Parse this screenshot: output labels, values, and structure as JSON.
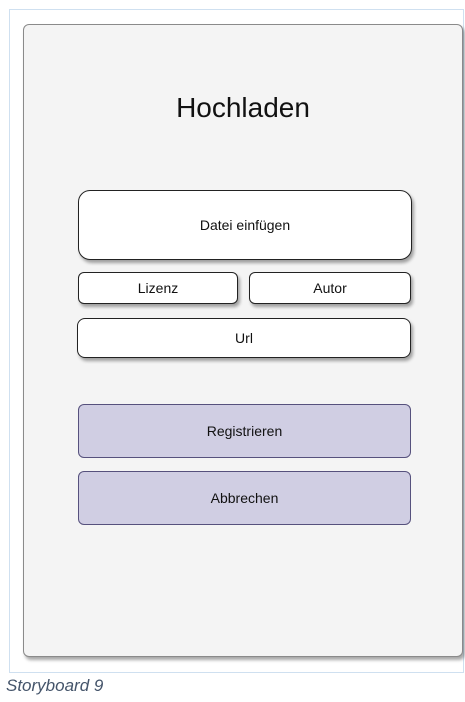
{
  "screen": {
    "title": "Hochladen"
  },
  "buttons": {
    "insert_file": "Datei einfügen",
    "license": "Lizenz",
    "author": "Autor",
    "url": "Url",
    "register": "Registrieren",
    "cancel": "Abbrechen"
  },
  "caption": "Storyboard 9",
  "colors": {
    "screen_background": "#f4f4f4",
    "primary_button_fill": "#d0cee3",
    "primary_button_border": "#56517d",
    "caption_text": "#44546a"
  }
}
